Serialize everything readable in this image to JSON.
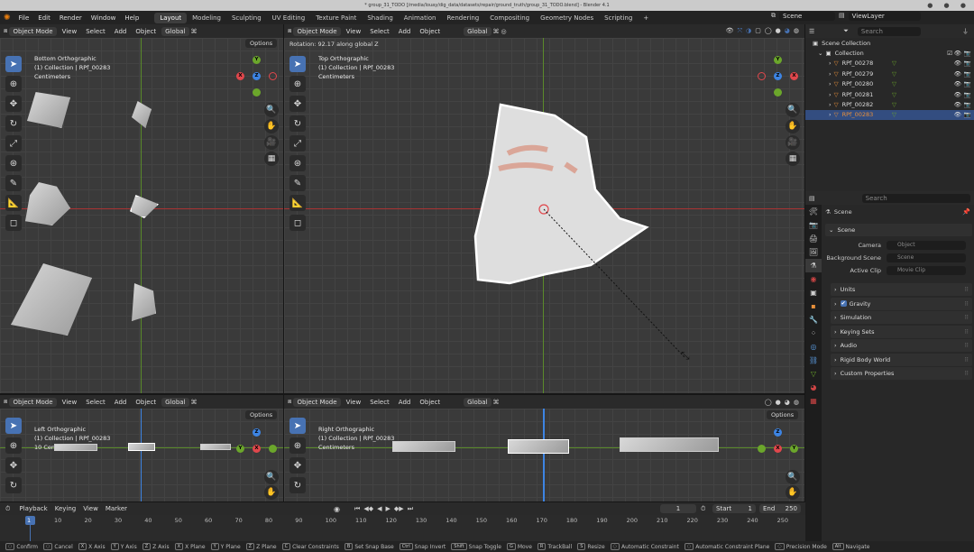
{
  "window_title": "* group_31_TODO [/media/louay/dig_data/datasets/repair/ground_truth/group_31_TODO.blend] - Blender 4.1",
  "menu": [
    "File",
    "Edit",
    "Render",
    "Window",
    "Help"
  ],
  "workspaces": [
    "Layout",
    "Modeling",
    "Sculpting",
    "UV Editing",
    "Texture Paint",
    "Shading",
    "Animation",
    "Rendering",
    "Compositing",
    "Geometry Nodes",
    "Scripting"
  ],
  "active_workspace": "Layout",
  "add_workspace": "+",
  "scene_name": "Scene",
  "view_layer": "ViewLayer",
  "viewport_header": {
    "mode": "Object Mode",
    "items": [
      "View",
      "Select",
      "Add",
      "Object"
    ],
    "transform": "Global",
    "options": "Options"
  },
  "status_overlay": "Rotation: 92.17 along global Z",
  "viewports": {
    "top_left": {
      "lines": [
        "Bottom Orthographic",
        "(1) Collection | RPf_00283",
        "Centimeters"
      ]
    },
    "top_main": {
      "lines": [
        "Top Orthographic",
        "(1) Collection | RPf_00283",
        "Centimeters"
      ]
    },
    "bottom_left": {
      "lines": [
        "Left Orthographic",
        "(1) Collection | RPf_00283",
        "10 Centimeters"
      ]
    },
    "bottom_right": {
      "lines": [
        "Right Orthographic",
        "(1) Collection | RPf_00283",
        "Centimeters"
      ]
    }
  },
  "gizmo_axes": {
    "x": "X",
    "y": "Y",
    "z": "Z"
  },
  "outliner": {
    "search_placeholder": "Search",
    "scene_collection": "Scene Collection",
    "collection": "Collection",
    "objects": [
      "RPf_00278",
      "RPf_00279",
      "RPf_00280",
      "RPf_00281",
      "RPf_00282",
      "RPf_00283"
    ],
    "selected_object": "RPf_00283"
  },
  "properties": {
    "search_placeholder": "Search",
    "breadcrumb": "Scene",
    "panel": "Scene",
    "fields": [
      {
        "label": "Camera",
        "placeholder": "Object"
      },
      {
        "label": "Background Scene",
        "placeholder": "Scene"
      },
      {
        "label": "Active Clip",
        "placeholder": "Movie Clip"
      }
    ],
    "sections": [
      "Units",
      "Gravity",
      "Simulation",
      "Keying Sets",
      "Audio",
      "Rigid Body World",
      "Custom Properties"
    ]
  },
  "timeline": {
    "menu": [
      "Playback",
      "Keying",
      "View",
      "Marker"
    ],
    "current_frame": "1",
    "start_label": "Start",
    "start": "1",
    "end_label": "End",
    "end": "250",
    "ticks": [
      "1",
      "10",
      "20",
      "30",
      "40",
      "50",
      "60",
      "70",
      "80",
      "90",
      "100",
      "110",
      "120",
      "130",
      "140",
      "150",
      "160",
      "170",
      "180",
      "190",
      "200",
      "210",
      "220",
      "230",
      "240",
      "250"
    ]
  },
  "statusbar": [
    {
      "key": "",
      "label": "Confirm"
    },
    {
      "key": "",
      "label": "Cancel"
    },
    {
      "key": "X",
      "label": "X Axis"
    },
    {
      "key": "Y",
      "label": "Y Axis"
    },
    {
      "key": "Z",
      "label": "Z Axis"
    },
    {
      "key": "X",
      "label": "X Plane"
    },
    {
      "key": "Y",
      "label": "Y Plane"
    },
    {
      "key": "Z",
      "label": "Z Plane"
    },
    {
      "key": "C",
      "label": "Clear Constraints"
    },
    {
      "key": "B",
      "label": "Set Snap Base"
    },
    {
      "key": "Ctrl",
      "label": "Snap Invert"
    },
    {
      "key": "Shift",
      "label": "Snap Toggle"
    },
    {
      "key": "G",
      "label": "Move"
    },
    {
      "key": "R",
      "label": "TrackBall"
    },
    {
      "key": "S",
      "label": "Resize"
    },
    {
      "key": "",
      "label": "Automatic Constraint"
    },
    {
      "key": "",
      "label": "Automatic Constraint Plane"
    },
    {
      "key": "",
      "label": "Precision Mode"
    },
    {
      "key": "Alt",
      "label": "Navigate"
    }
  ],
  "colors": {
    "accent": "#4772b3",
    "x_axis": "#e0474c",
    "y_axis": "#6ba62b",
    "z_axis": "#3d84e3",
    "object_orange": "#e8903b"
  }
}
